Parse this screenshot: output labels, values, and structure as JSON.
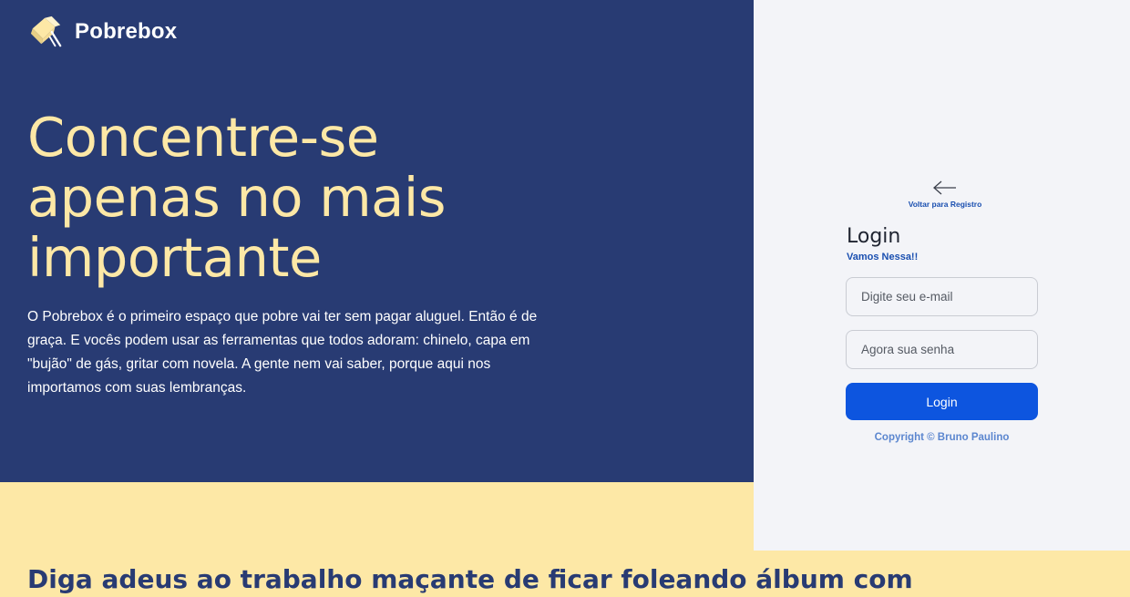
{
  "brand": {
    "name": "Pobrebox",
    "logo_icon": "box-icon"
  },
  "hero": {
    "title": "Concentre-se apenas no mais importante",
    "description": "O Pobrebox é o primeiro espaço que pobre vai ter sem pagar aluguel. Então é de graça. E vocês podem usar as ferramentas que todos adoram: chinelo, capa em \"bujão\" de gás, gritar com novela. A gente nem vai saber, porque aqui nos importamos com suas lembranças."
  },
  "section": {
    "tagline": "Diga adeus ao trabalho maçante de ficar foleando álbum com"
  },
  "login": {
    "back_icon": "arrow-left-icon",
    "back_label": "Voltar para Registro",
    "title": "Login",
    "subtitle": "Vamos Nessa!!",
    "email_placeholder": "Digite seu e-mail",
    "password_placeholder": "Agora sua senha",
    "submit_label": "Login",
    "copyright": "Copyright © Bruno Paulino"
  },
  "colors": {
    "hero_bg": "#283b73",
    "accent_yellow": "#fde8a6",
    "panel_bg": "#f3f4f8",
    "primary_button": "#0d55df",
    "link_blue": "#1a4fb0"
  }
}
